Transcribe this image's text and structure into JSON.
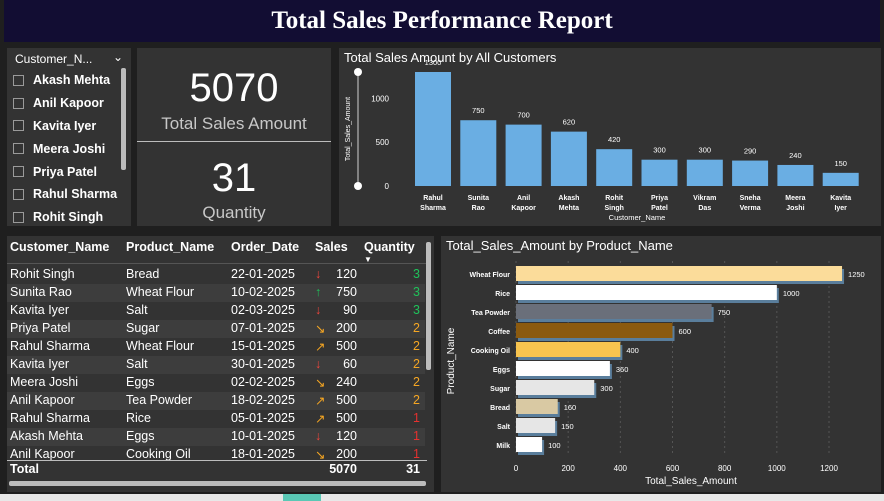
{
  "header": {
    "title": "Total Sales Performance Report"
  },
  "slicer": {
    "header": "Customer_N...",
    "items": [
      "Akash Mehta",
      "Anil Kapoor",
      "Kavita Iyer",
      "Meera Joshi",
      "Priya Patel",
      "Rahul Sharma",
      "Rohit Singh"
    ]
  },
  "kpi": {
    "sales_value": "5070",
    "sales_label": "Total Sales Amount",
    "qty_value": "31",
    "qty_label": "Quantity"
  },
  "table": {
    "columns": [
      "Customer_Name",
      "Product_Name",
      "Order_Date",
      "Sales",
      "Quantity"
    ],
    "rows": [
      {
        "customer": "Rohit Singh",
        "product": "Bread",
        "date": "22-01-2025",
        "trend": "down",
        "sales": "120",
        "qty": "3"
      },
      {
        "customer": "Sunita Rao",
        "product": "Wheat Flour",
        "date": "10-02-2025",
        "trend": "up",
        "sales": "750",
        "qty": "3"
      },
      {
        "customer": "Kavita Iyer",
        "product": "Salt",
        "date": "02-03-2025",
        "trend": "down",
        "sales": "90",
        "qty": "3"
      },
      {
        "customer": "Priya Patel",
        "product": "Sugar",
        "date": "07-01-2025",
        "trend": "down-right",
        "sales": "200",
        "qty": "2"
      },
      {
        "customer": "Rahul Sharma",
        "product": "Wheat Flour",
        "date": "15-01-2025",
        "trend": "up-right",
        "sales": "500",
        "qty": "2"
      },
      {
        "customer": "Kavita Iyer",
        "product": "Salt",
        "date": "30-01-2025",
        "trend": "down",
        "sales": "60",
        "qty": "2"
      },
      {
        "customer": "Meera Joshi",
        "product": "Eggs",
        "date": "02-02-2025",
        "trend": "down-right",
        "sales": "240",
        "qty": "2"
      },
      {
        "customer": "Anil Kapoor",
        "product": "Tea Powder",
        "date": "18-02-2025",
        "trend": "up-right",
        "sales": "500",
        "qty": "2"
      },
      {
        "customer": "Rahul Sharma",
        "product": "Rice",
        "date": "05-01-2025",
        "trend": "up-right",
        "sales": "500",
        "qty": "1"
      },
      {
        "customer": "Akash Mehta",
        "product": "Eggs",
        "date": "10-01-2025",
        "trend": "down",
        "sales": "120",
        "qty": "1"
      },
      {
        "customer": "Anil Kapoor",
        "product": "Cooking Oil",
        "date": "18-01-2025",
        "trend": "down-right",
        "sales": "200",
        "qty": "1"
      }
    ],
    "total_label": "Total",
    "total_sales": "5070",
    "total_qty": "31",
    "trend_colors": {
      "up": "#1fc25a",
      "down": "#f2453d",
      "up-right": "#f5a623",
      "down-right": "#f5a623"
    },
    "qty_colors": {
      "3": "#1fc25a",
      "2": "#f5a623",
      "1": "#e5312f"
    }
  },
  "chart_data": [
    {
      "type": "bar",
      "title": "Total Sales Amount by All Customers",
      "xlabel": "Customer_Name",
      "ylabel": "Total_Sales_Amount",
      "categories": [
        [
          "Rahul",
          "Sharma"
        ],
        [
          "Sunita",
          "Rao"
        ],
        [
          "Anil",
          "Kapoor"
        ],
        [
          "Akash",
          "Mehta"
        ],
        [
          "Rohit",
          "Singh"
        ],
        [
          "Priya",
          "Patel"
        ],
        [
          "Vikram",
          "Das"
        ],
        [
          "Sneha",
          "Verma"
        ],
        [
          "Meera",
          "Joshi"
        ],
        [
          "Kavita",
          "Iyer"
        ]
      ],
      "values": [
        1300,
        750,
        700,
        620,
        420,
        300,
        300,
        290,
        240,
        150
      ],
      "ylim": [
        0,
        1300
      ],
      "yticks": [
        0,
        500,
        1000
      ],
      "color": "#6aaee3"
    },
    {
      "type": "bar",
      "orientation": "horizontal",
      "title": "Total_Sales_Amount by Product_Name",
      "xlabel": "Total_Sales_Amount",
      "ylabel": "Product_Name",
      "categories": [
        "Wheat Flour",
        "Rice",
        "Tea Powder",
        "Coffee",
        "Cooking Oil",
        "Eggs",
        "Sugar",
        "Bread",
        "Salt",
        "Milk"
      ],
      "values": [
        1250,
        1000,
        750,
        600,
        400,
        360,
        300,
        160,
        150,
        100
      ],
      "xticks": [
        0,
        200,
        400,
        600,
        800,
        1000,
        1200
      ],
      "colors": [
        "#fbdc9a",
        "#ffffff",
        "#6a6f7a",
        "#8b5a0f",
        "#f7c44f",
        "#ffffff",
        "#e6e6e6",
        "#d9c9a3",
        "#e6e6e6",
        "#ffffff"
      ]
    }
  ]
}
